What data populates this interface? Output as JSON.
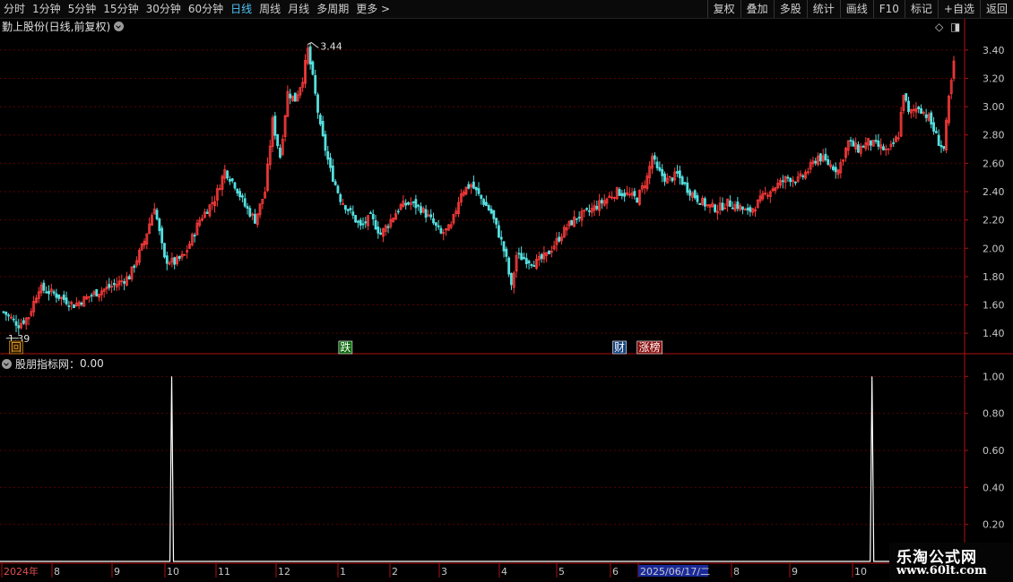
{
  "toolbar": {
    "periods": [
      "分时",
      "1分钟",
      "5分钟",
      "15分钟",
      "30分钟",
      "60分钟",
      "日线",
      "周线",
      "月线",
      "多周期",
      "更多 >"
    ],
    "active_period": "日线",
    "actions": [
      "复权",
      "叠加",
      "多股",
      "统计",
      "画线",
      "F10",
      "标记",
      "+自选",
      "返回"
    ]
  },
  "main_panel": {
    "title": "勤上股份(日线,前复权)",
    "high_label": "3.44",
    "low_label": "1.39",
    "markers": [
      {
        "text": "回",
        "color": "#f0a020",
        "bg": "#2a1a00",
        "date_index": 5
      },
      {
        "text": "跌",
        "color": "#ffffff",
        "bg": "#0a6a0a",
        "date_index": 136
      },
      {
        "text": "财",
        "color": "#ffffff",
        "bg": "#12407a",
        "date_index": 245
      },
      {
        "text": "涨榜",
        "color": "#ffffff",
        "bg": "#8a1010",
        "date_index": 257
      }
    ]
  },
  "sub_panel": {
    "title": "股朋指标网：",
    "value": "0.00"
  },
  "date_axis": {
    "labels": [
      "2024年",
      "8",
      "9",
      "10",
      "11",
      "12",
      "1",
      "2",
      "3",
      "4",
      "5",
      "6",
      "2025/06/17/二",
      "8",
      "9",
      "10"
    ]
  },
  "logo": {
    "line1": "乐淘公式网",
    "line2": "www.60lt.com"
  },
  "colors": {
    "up": "#ff3b3b",
    "down": "#55e0e0",
    "axis": "#b01010",
    "grid": "#5a0000",
    "text": "#c8c8c8",
    "spike": "#ffffff"
  },
  "chart_data": [
    {
      "type": "candlestick",
      "title": "勤上股份(日线,前复权)",
      "y_ticks": [
        1.4,
        1.6,
        1.8,
        2.0,
        2.2,
        2.4,
        2.6,
        2.8,
        3.0,
        3.2,
        3.4
      ],
      "ylim": [
        1.3,
        3.5
      ],
      "high": 3.44,
      "low": 1.39,
      "close_path": [
        [
          0,
          1.55
        ],
        [
          6,
          1.46
        ],
        [
          10,
          1.52
        ],
        [
          14,
          1.72
        ],
        [
          20,
          1.68
        ],
        [
          28,
          1.6
        ],
        [
          36,
          1.68
        ],
        [
          44,
          1.74
        ],
        [
          50,
          1.8
        ],
        [
          56,
          2.05
        ],
        [
          60,
          2.3
        ],
        [
          64,
          1.92
        ],
        [
          68,
          1.9
        ],
        [
          72,
          1.95
        ],
        [
          78,
          2.2
        ],
        [
          84,
          2.35
        ],
        [
          88,
          2.55
        ],
        [
          92,
          2.45
        ],
        [
          96,
          2.3
        ],
        [
          100,
          2.2
        ],
        [
          104,
          2.4
        ],
        [
          107,
          2.9
        ],
        [
          110,
          2.65
        ],
        [
          113,
          3.1
        ],
        [
          116,
          3.05
        ],
        [
          119,
          3.2
        ],
        [
          121,
          3.4
        ],
        [
          123,
          3.2
        ],
        [
          126,
          2.85
        ],
        [
          130,
          2.55
        ],
        [
          134,
          2.35
        ],
        [
          138,
          2.25
        ],
        [
          142,
          2.15
        ],
        [
          146,
          2.22
        ],
        [
          150,
          2.1
        ],
        [
          154,
          2.2
        ],
        [
          158,
          2.3
        ],
        [
          162,
          2.32
        ],
        [
          166,
          2.28
        ],
        [
          170,
          2.2
        ],
        [
          174,
          2.1
        ],
        [
          178,
          2.15
        ],
        [
          182,
          2.4
        ],
        [
          186,
          2.45
        ],
        [
          190,
          2.35
        ],
        [
          194,
          2.25
        ],
        [
          198,
          2.05
        ],
        [
          200,
          1.92
        ],
        [
          202,
          1.72
        ],
        [
          204,
          1.95
        ],
        [
          208,
          1.92
        ],
        [
          212,
          1.9
        ],
        [
          216,
          1.95
        ],
        [
          220,
          2.05
        ],
        [
          224,
          2.15
        ],
        [
          228,
          2.22
        ],
        [
          232,
          2.25
        ],
        [
          236,
          2.3
        ],
        [
          240,
          2.35
        ],
        [
          244,
          2.4
        ],
        [
          248,
          2.38
        ],
        [
          252,
          2.35
        ],
        [
          256,
          2.5
        ],
        [
          258,
          2.65
        ],
        [
          260,
          2.55
        ],
        [
          264,
          2.48
        ],
        [
          268,
          2.52
        ],
        [
          272,
          2.42
        ],
        [
          276,
          2.35
        ],
        [
          280,
          2.3
        ],
        [
          284,
          2.28
        ],
        [
          288,
          2.32
        ],
        [
          292,
          2.3
        ],
        [
          296,
          2.25
        ],
        [
          300,
          2.32
        ],
        [
          304,
          2.4
        ],
        [
          308,
          2.45
        ],
        [
          312,
          2.5
        ],
        [
          316,
          2.48
        ],
        [
          320,
          2.55
        ],
        [
          324,
          2.65
        ],
        [
          328,
          2.6
        ],
        [
          332,
          2.55
        ],
        [
          336,
          2.75
        ],
        [
          340,
          2.7
        ],
        [
          344,
          2.75
        ],
        [
          348,
          2.72
        ],
        [
          352,
          2.68
        ],
        [
          356,
          2.8
        ],
        [
          358,
          3.1
        ],
        [
          360,
          2.95
        ],
        [
          364,
          3.0
        ],
        [
          368,
          2.92
        ],
        [
          372,
          2.75
        ],
        [
          374,
          2.7
        ],
        [
          376,
          3.05
        ],
        [
          378,
          3.3
        ]
      ],
      "up_color": "#ff3b3b",
      "down_color": "#55e0e0"
    },
    {
      "type": "line",
      "title": "股朋指标网",
      "y_ticks": [
        0.2,
        0.4,
        0.6,
        0.8,
        1.0
      ],
      "ylim": [
        0.0,
        1.05
      ],
      "series": [
        {
          "values_zero_except": [
            {
              "x_frac": 0.178,
              "y": 1.0
            },
            {
              "x_frac": 0.904,
              "y": 1.0
            }
          ]
        }
      ]
    }
  ]
}
